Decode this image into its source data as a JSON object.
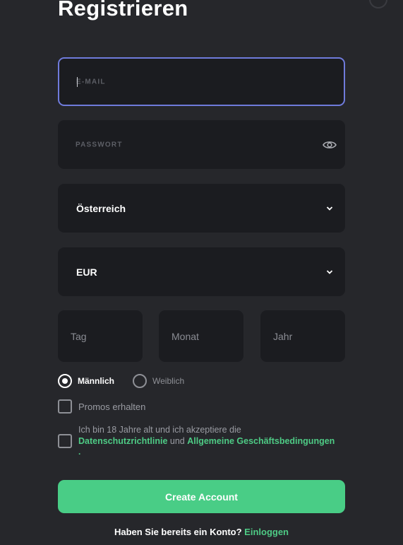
{
  "page": {
    "title": "Registrieren"
  },
  "form": {
    "email": {
      "placeholder": "E-MAIL"
    },
    "password": {
      "placeholder": "PASSWORT",
      "toggle_icon": "eye-icon"
    },
    "country": {
      "value": "Österreich",
      "icon": "chevron-down-icon"
    },
    "currency": {
      "value": "EUR",
      "icon": "chevron-down-icon"
    },
    "birthdate": {
      "day": "Tag",
      "month": "Monat",
      "year": "Jahr"
    },
    "gender": {
      "options": [
        {
          "label": "Männlich",
          "selected": true
        },
        {
          "label": "Weiblich",
          "selected": false
        }
      ]
    },
    "promos": {
      "label": "Promos erhalten",
      "checked": false
    },
    "terms": {
      "text_before": "Ich bin 18 Jahre alt und ich akzeptiere die ",
      "privacy_link": "Datenschutzrichtlinie",
      "joiner": " und ",
      "terms_link": "Allgemeine Geschäftsbedingungen",
      "trailing": ".",
      "checked": false
    },
    "submit_label": "Create Account"
  },
  "footer": {
    "question": "Haben Sie bereits ein Konto? ",
    "login_link": "Einloggen"
  },
  "colors": {
    "background": "#26272b",
    "field": "#1b1c20",
    "focus_border": "#6f7bdb",
    "accent_green": "#49cd86"
  }
}
